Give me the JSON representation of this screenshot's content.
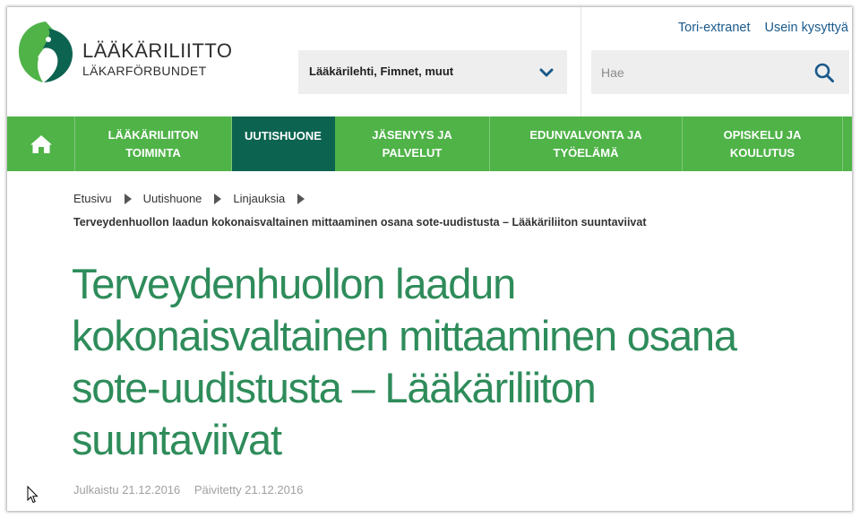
{
  "header": {
    "logo_line1": "LÄÄKÄRILIITTO",
    "logo_line2": "LÄKARFÖRBUNDET",
    "dropdown_label": "Lääkärilehti, Fimnet, muut",
    "top_links": [
      "Tori-extranet",
      "Usein kysyttyä"
    ],
    "search_placeholder": "Hae"
  },
  "nav": {
    "home_icon": "home-icon",
    "items": [
      {
        "line1": "LÄÄKÄRILIITON",
        "line2": "TOIMINTA"
      },
      {
        "line1": "UUTISHUONE",
        "line2": ""
      },
      {
        "line1": "JÄSENYYS JA",
        "line2": "PALVELUT"
      },
      {
        "line1": "EDUNVALVONTA JA",
        "line2": "TYÖELÄMÄ"
      },
      {
        "line1": "OPISKELU JA",
        "line2": "KOULUTUS"
      }
    ]
  },
  "breadcrumb": {
    "items": [
      "Etusivu",
      "Uutishuone",
      "Linjauksia"
    ],
    "current": "Terveydenhuollon laadun kokonaisvaltainen mittaaminen osana sote-uudistusta – Lääkäriliiton suuntaviivat"
  },
  "article": {
    "title": "Terveydenhuollon laadun kokonaisvaltainen mittaaminen osana sote-uudistusta – Lääkäriliiton suuntaviivat",
    "published": "Julkaistu 21.12.2016",
    "updated": "Päivitetty 21.12.2016"
  },
  "colors": {
    "nav_green": "#4fb348",
    "nav_active": "#0c6350",
    "title_green": "#2e8c5a",
    "link_blue": "#1a5a8c"
  }
}
